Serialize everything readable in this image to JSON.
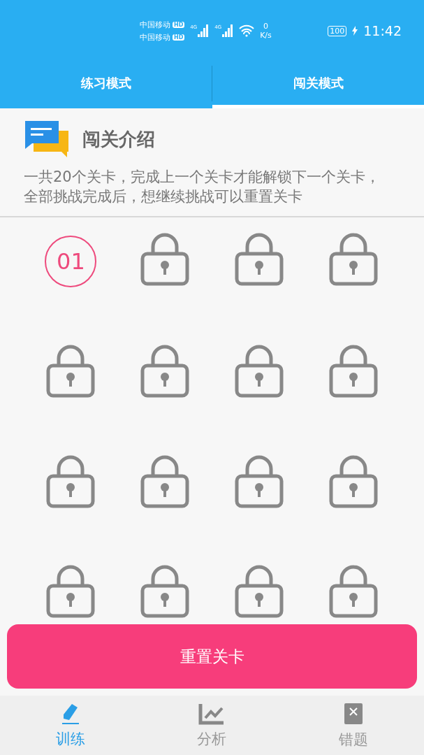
{
  "status_bar": {
    "carriers": [
      {
        "name": "中国移动",
        "badge": "HD"
      },
      {
        "name": "中国移动",
        "badge": "HD"
      }
    ],
    "network": [
      "4G",
      "4G"
    ],
    "speed_value": "0",
    "speed_unit": "K/s",
    "battery": "100",
    "time": "11:42"
  },
  "tabs": [
    {
      "label": "练习模式",
      "selected": false
    },
    {
      "label": "闯关模式",
      "selected": true
    }
  ],
  "intro": {
    "title": "闯关介绍",
    "text": "一共20个关卡，完成上一个关卡才能解锁下一个关卡，全部挑战完成后，想继续挑战可以重置关卡"
  },
  "levels": [
    {
      "kind": "unlocked",
      "label": "01"
    },
    {
      "kind": "locked"
    },
    {
      "kind": "locked"
    },
    {
      "kind": "locked"
    },
    {
      "kind": "locked"
    },
    {
      "kind": "locked"
    },
    {
      "kind": "locked"
    },
    {
      "kind": "locked"
    },
    {
      "kind": "locked"
    },
    {
      "kind": "locked"
    },
    {
      "kind": "locked"
    },
    {
      "kind": "locked"
    },
    {
      "kind": "locked"
    },
    {
      "kind": "locked"
    },
    {
      "kind": "locked"
    },
    {
      "kind": "locked"
    }
  ],
  "reset_button": "重置关卡",
  "bottom_nav": [
    {
      "label": "训练",
      "kind": "pencil",
      "selected": true
    },
    {
      "label": "分析",
      "kind": "chart",
      "selected": false
    },
    {
      "label": "错题",
      "kind": "note",
      "selected": false
    }
  ]
}
